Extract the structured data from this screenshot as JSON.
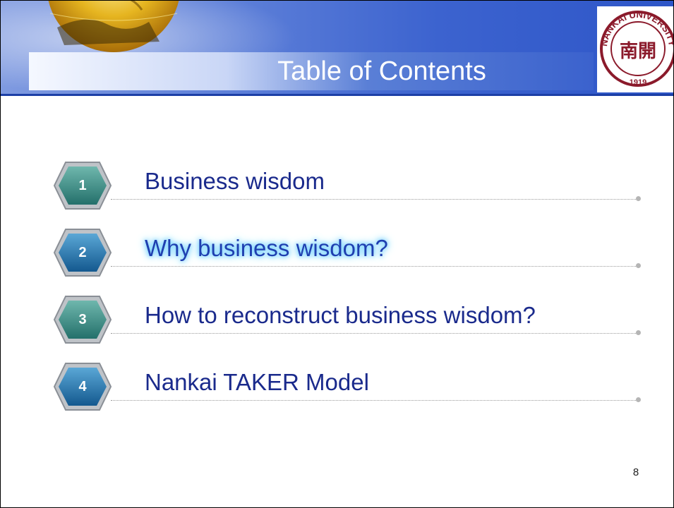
{
  "slide": {
    "title": "Table of Contents",
    "page_number": "8",
    "seal": {
      "top_text": "NANKAI UNIVERSITY",
      "year": "1919",
      "center_glyphs": "南開"
    },
    "items": [
      {
        "number": "1",
        "label": "Business wisdom",
        "highlighted": false
      },
      {
        "number": "2",
        "label": "Why business wisdom?",
        "highlighted": true
      },
      {
        "number": "3",
        "label": "How to reconstruct business wisdom?",
        "highlighted": false
      },
      {
        "number": "4",
        "label": "Nankai TAKER Model",
        "highlighted": false
      }
    ]
  },
  "colors": {
    "header_blue": "#3c63cf",
    "item_text": "#1a2a8c",
    "highlight_glow": "#6fd0ff",
    "seal_red": "#8b1a2b",
    "hex_teal": "#3c8f8a",
    "hex_blue": "#1e6aa8"
  },
  "icons": [
    "globe-icon",
    "university-seal-icon",
    "hexagon-number-badge-icon"
  ]
}
